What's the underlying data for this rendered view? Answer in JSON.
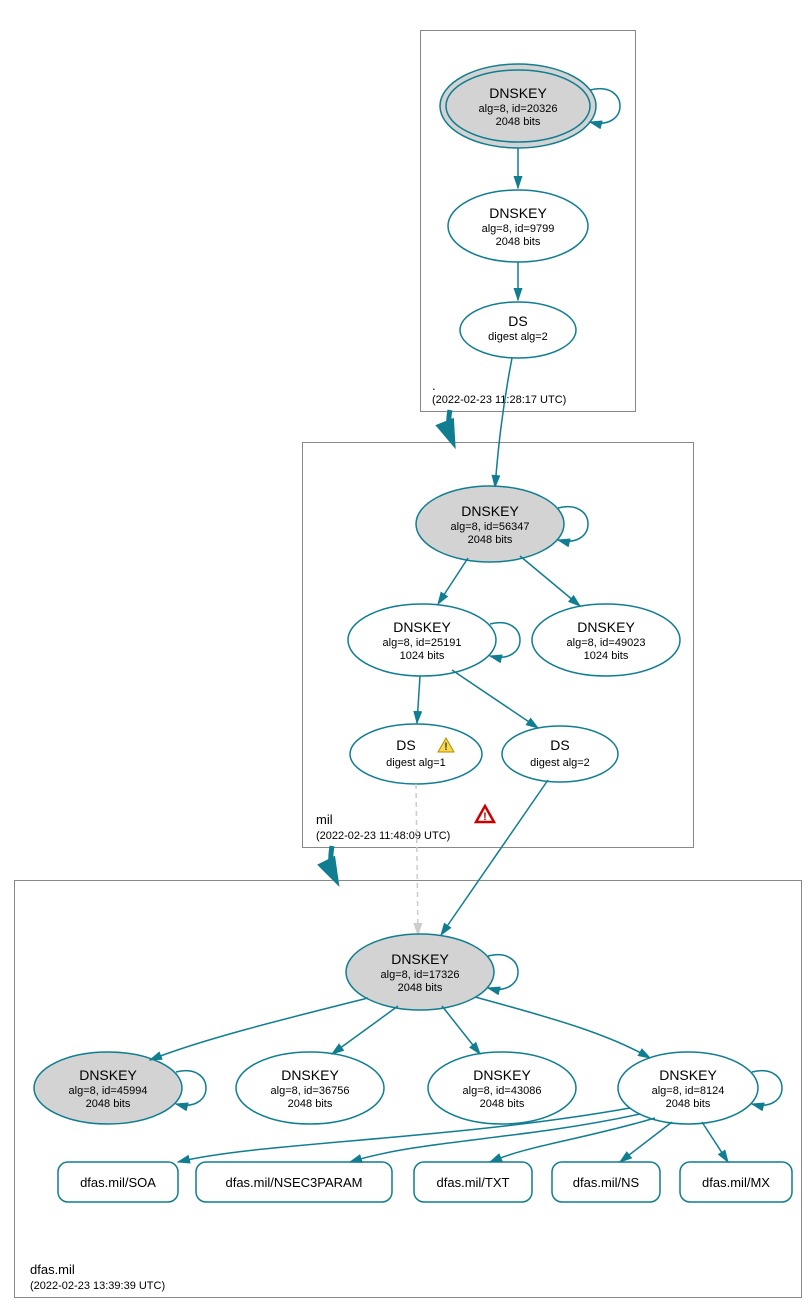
{
  "zones": {
    "root": {
      "label": ".",
      "timestamp": "(2022-02-23 11:28:17 UTC)",
      "nodes": {
        "dnskey_20326": {
          "title": "DNSKEY",
          "line2": "alg=8, id=20326",
          "line3": "2048 bits"
        },
        "dnskey_9799": {
          "title": "DNSKEY",
          "line2": "alg=8, id=9799",
          "line3": "2048 bits"
        },
        "ds_alg2": {
          "title": "DS",
          "line2": "digest alg=2"
        }
      }
    },
    "mil": {
      "label": "mil",
      "timestamp": "(2022-02-23 11:48:09 UTC)",
      "nodes": {
        "dnskey_56347": {
          "title": "DNSKEY",
          "line2": "alg=8, id=56347",
          "line3": "2048 bits"
        },
        "dnskey_25191": {
          "title": "DNSKEY",
          "line2": "alg=8, id=25191",
          "line3": "1024 bits"
        },
        "dnskey_49023": {
          "title": "DNSKEY",
          "line2": "alg=8, id=49023",
          "line3": "1024 bits"
        },
        "ds_alg1": {
          "title": "DS",
          "line2": "digest alg=1",
          "warning": true
        },
        "ds_alg2": {
          "title": "DS",
          "line2": "digest alg=2"
        }
      }
    },
    "dfas": {
      "label": "dfas.mil",
      "timestamp": "(2022-02-23 13:39:39 UTC)",
      "nodes": {
        "dnskey_17326": {
          "title": "DNSKEY",
          "line2": "alg=8, id=17326",
          "line3": "2048 bits"
        },
        "dnskey_45994": {
          "title": "DNSKEY",
          "line2": "alg=8, id=45994",
          "line3": "2048 bits"
        },
        "dnskey_36756": {
          "title": "DNSKEY",
          "line2": "alg=8, id=36756",
          "line3": "2048 bits"
        },
        "dnskey_43086": {
          "title": "DNSKEY",
          "line2": "alg=8, id=43086",
          "line3": "2048 bits"
        },
        "dnskey_8124": {
          "title": "DNSKEY",
          "line2": "alg=8, id=8124",
          "line3": "2048 bits"
        }
      },
      "records": {
        "soa": "dfas.mil/SOA",
        "nsec3param": "dfas.mil/NSEC3PARAM",
        "txt": "dfas.mil/TXT",
        "ns": "dfas.mil/NS",
        "mx": "dfas.mil/MX"
      }
    }
  },
  "colors": {
    "stroke": "#107d91",
    "filled": "#d3d3d3",
    "box_border": "#888888"
  }
}
